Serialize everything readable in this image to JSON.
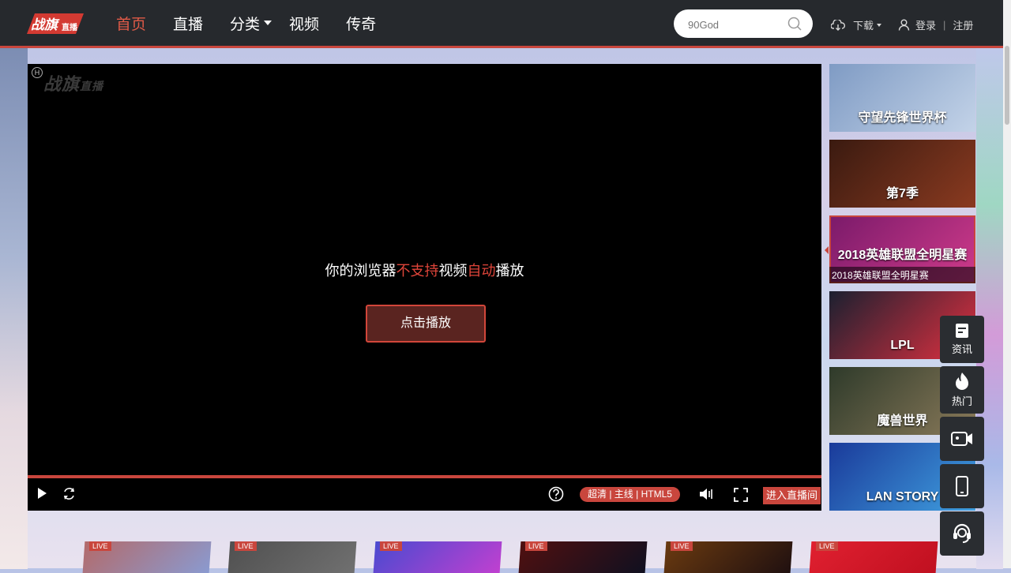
{
  "brand": {
    "logo_text": "战旗",
    "logo_sub": "直播"
  },
  "nav": {
    "items": [
      {
        "label": "首页",
        "active": true
      },
      {
        "label": "直播",
        "active": false
      },
      {
        "label": "分类",
        "active": false,
        "dropdown": true
      },
      {
        "label": "视频",
        "active": false
      },
      {
        "label": "传奇",
        "active": false
      }
    ]
  },
  "search": {
    "value": "",
    "placeholder": "90God",
    "icon": "search-icon"
  },
  "header": {
    "download_label": "下载",
    "login_label": "登录",
    "register_label": "注册"
  },
  "player": {
    "watermark": "战旗",
    "watermark_sub": "直播",
    "hbadge": "H",
    "message_parts": [
      "你的浏览器",
      "不支持",
      "视频",
      "自动",
      "播放"
    ],
    "play_button": "点击播放",
    "quality": "超清 | 主线 | HTML5",
    "enter_room": "进入直播间"
  },
  "thumbnails": [
    {
      "title": "守望先锋世界杯",
      "caption": "",
      "colors": [
        "#7f9bc4",
        "#c3d3e8"
      ]
    },
    {
      "title": "第7季",
      "caption": "",
      "colors": [
        "#3a1a10",
        "#8a3a20"
      ]
    },
    {
      "title": "2018英雄联盟全明星赛",
      "caption": "2018英雄联盟全明星赛",
      "colors": [
        "#7a1a6a",
        "#d03b8a"
      ],
      "selected": true
    },
    {
      "title": "LPL",
      "caption": "",
      "colors": [
        "#1b2030",
        "#e03040"
      ]
    },
    {
      "title": "魔兽世界",
      "caption": "",
      "colors": [
        "#2e3a2a",
        "#8a7a5a"
      ]
    },
    {
      "title": "LAN STORY",
      "caption": "",
      "colors": [
        "#1a3a9a",
        "#40a0e0"
      ]
    }
  ],
  "tools": [
    {
      "label": "资讯",
      "icon": "news-icon"
    },
    {
      "label": "热门",
      "icon": "fire-icon"
    },
    {
      "label": "",
      "icon": "camera-icon"
    },
    {
      "label": "",
      "icon": "mobile-icon"
    },
    {
      "label": "",
      "icon": "support-icon"
    }
  ],
  "live_cards": [
    {
      "tag": "LIVE",
      "colors": [
        "#b36a6a",
        "#8a9ad0"
      ]
    },
    {
      "tag": "LIVE",
      "colors": [
        "#505050",
        "#707070"
      ]
    },
    {
      "tag": "LIVE",
      "colors": [
        "#4a4ad0",
        "#c040d0"
      ]
    },
    {
      "tag": "LIVE",
      "colors": [
        "#501010",
        "#101020"
      ]
    },
    {
      "tag": "LIVE",
      "colors": [
        "#6a3a10",
        "#201010"
      ]
    },
    {
      "tag": "LIVE",
      "colors": [
        "#e02030",
        "#c01020"
      ]
    }
  ],
  "colors": {
    "accent": "#c9463d",
    "nav_bg": "#26292d"
  }
}
